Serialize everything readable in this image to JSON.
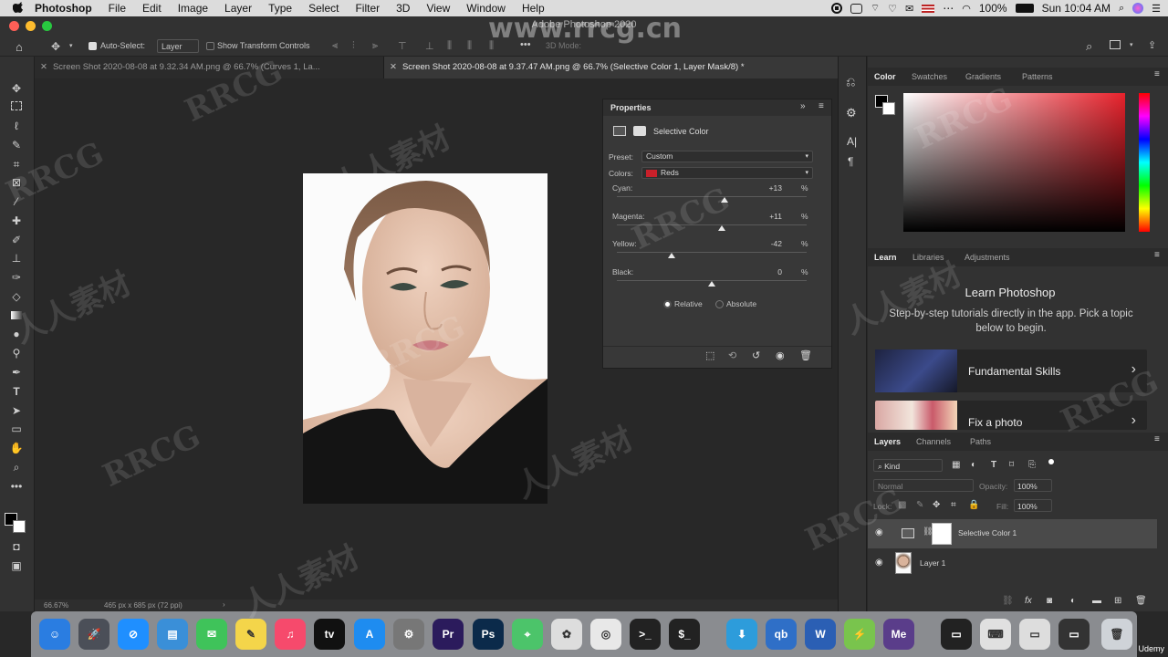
{
  "menubar": {
    "items": [
      "Photoshop",
      "File",
      "Edit",
      "Image",
      "Layer",
      "Type",
      "Select",
      "Filter",
      "3D",
      "View",
      "Window",
      "Help"
    ],
    "battery": "100%",
    "clock": "Sun 10:04 AM"
  },
  "window": {
    "title": "Adobe Photoshop 2020"
  },
  "options": {
    "auto_select": "Auto-Select:",
    "target": "Layer",
    "show_transform": "Show Transform Controls",
    "mode_3d": "3D Mode:"
  },
  "tabs": [
    {
      "label": "Screen Shot 2020-08-08 at 9.32.34 AM.png @ 66.7% (Curves 1, La..."
    },
    {
      "label": "Screen Shot 2020-08-08 at 9.37.47 AM.png @ 66.7% (Selective Color 1, Layer Mask/8) *"
    }
  ],
  "status": {
    "zoom": "66.67%",
    "doc_size": "465 px x 685 px (72 ppi)"
  },
  "properties": {
    "title": "Properties",
    "adjustment": "Selective Color",
    "preset_label": "Preset:",
    "preset_value": "Custom",
    "colors_label": "Colors:",
    "colors_value": "Reds",
    "colors_swatch": "#c8202a",
    "sliders": [
      {
        "label": "Cyan:",
        "value": "+13",
        "unit": "%",
        "fraction": 0.565
      },
      {
        "label": "Magenta:",
        "value": "+11",
        "unit": "%",
        "fraction": 0.555
      },
      {
        "label": "Yellow:",
        "value": "-42",
        "unit": "%",
        "fraction": 0.29
      },
      {
        "label": "Black:",
        "value": "0",
        "unit": "%",
        "fraction": 0.5
      }
    ],
    "method_relative": "Relative",
    "method_absolute": "Absolute"
  },
  "color_panel": {
    "tabs": [
      "Color",
      "Swatches",
      "Gradients",
      "Patterns"
    ]
  },
  "learn_panel": {
    "tabs": [
      "Learn",
      "Libraries",
      "Adjustments"
    ],
    "heading": "Learn Photoshop",
    "description": "Step-by-step tutorials directly in the app. Pick a topic below to begin.",
    "cards": [
      "Fundamental Skills",
      "Fix a photo"
    ]
  },
  "layers_panel": {
    "tabs": [
      "Layers",
      "Channels",
      "Paths"
    ],
    "filter": "Kind",
    "blend_mode": "Normal",
    "opacity_label": "Opacity:",
    "opacity": "100%",
    "lock_label": "Lock:",
    "fill_label": "Fill:",
    "fill": "100%",
    "layers": [
      "Selective Color 1",
      "Layer 1"
    ]
  },
  "dock": {
    "apps": [
      "Finder",
      "Launchpad",
      "Safari",
      "Preview",
      "Messages",
      "Notes",
      "Music",
      "TV",
      "App Store",
      "System Preferences",
      "Premiere Pro",
      "Photoshop",
      "Maps",
      "Photos",
      "Chrome",
      "Terminal",
      "Console",
      "Downloader",
      "qBittorrent",
      "Word",
      "Android File Transfer",
      "Media Encoder",
      "Finder Window",
      "Keyboard",
      "Preview Window",
      "Screen Window",
      "Trash"
    ]
  },
  "watermarks": {
    "site": "www.rrcg.cn",
    "brand": "RRCG",
    "cn": "人人素材",
    "udemy": "Udemy"
  }
}
